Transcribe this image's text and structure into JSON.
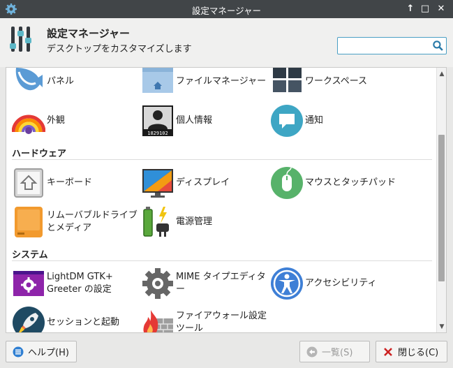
{
  "window": {
    "title": "設定マネージャー",
    "controls": {
      "pin": "↑",
      "maximize": "□",
      "close": "✕"
    }
  },
  "header": {
    "title": "設定マネージャー",
    "subtitle": "デスクトップをカスタマイズします"
  },
  "search": {
    "value": "",
    "placeholder": ""
  },
  "personal": {
    "panel": "パネル",
    "file_manager": "ファイルマネージャー",
    "workspaces": "ワークスペース",
    "appearance": "外観",
    "about_me": "個人情報",
    "about_me_badge": "1829102",
    "notifications": "通知"
  },
  "hardware": {
    "heading": "ハードウェア",
    "keyboard": "キーボード",
    "display": "ディスプレイ",
    "mouse": "マウスとタッチパッド",
    "removable": "リムーバブルドライブとメディア",
    "power": "電源管理"
  },
  "system": {
    "heading": "システム",
    "lightdm": "LightDM GTK+ Greeter の設定",
    "mime": "MIME タイプエディター",
    "accessibility": "アクセシビリティ",
    "session": "セッションと起動",
    "firewall": "ファイアウォール設定ツール"
  },
  "footer": {
    "help": "ヘルプ(H)",
    "overview": "一覧(S)",
    "close": "閉じる(C)"
  },
  "colors": {
    "titlebar": "#414548",
    "accent": "#4a9fc4",
    "close_red": "#cc2222"
  }
}
